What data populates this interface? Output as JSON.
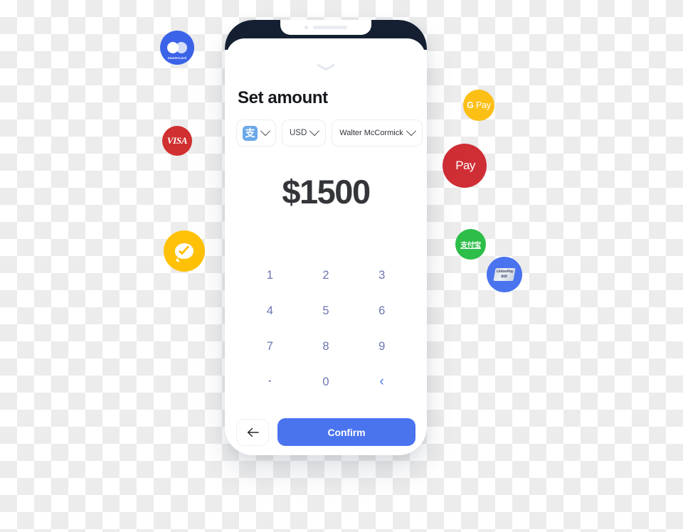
{
  "screen": {
    "title": "Set amount",
    "amount": "$1500",
    "selectors": [
      {
        "name": "payment-method",
        "icon": "alipay-icon",
        "glyph": "支",
        "label": ""
      },
      {
        "name": "currency",
        "label": "USD"
      },
      {
        "name": "recipient",
        "label": "Walter McCormick"
      }
    ],
    "keypad": [
      {
        "key": "1",
        "type": "digit"
      },
      {
        "key": "2",
        "type": "digit"
      },
      {
        "key": "3",
        "type": "digit"
      },
      {
        "key": "4",
        "type": "digit"
      },
      {
        "key": "5",
        "type": "digit"
      },
      {
        "key": "6",
        "type": "digit"
      },
      {
        "key": "7",
        "type": "digit"
      },
      {
        "key": "8",
        "type": "digit"
      },
      {
        "key": "9",
        "type": "digit"
      },
      {
        "key": "·",
        "type": "decimal"
      },
      {
        "key": "0",
        "type": "digit"
      },
      {
        "key": "‹",
        "type": "backspace"
      }
    ],
    "back_button_glyph": "←",
    "confirm_label": "Confirm"
  },
  "badges": [
    {
      "name": "mastercard",
      "label": "mastercard",
      "color": "#3b63e8"
    },
    {
      "name": "visa",
      "label": "VISA",
      "color": "#d0302f"
    },
    {
      "name": "wechat-pay",
      "label": "",
      "color": "#ffc107"
    },
    {
      "name": "google-pay",
      "label_g": "G",
      "label_pay": "Pay",
      "color": "#fcbf16"
    },
    {
      "name": "apple-pay",
      "glyph": "",
      "label": "Pay",
      "color": "#cf2e35"
    },
    {
      "name": "alipay",
      "label": "支付宝",
      "color": "#2dbd49"
    },
    {
      "name": "unionpay",
      "label_l1": "UnionPay",
      "label_l2": "银联",
      "color": "#4a73ee"
    }
  ],
  "colors": {
    "accent_blue": "#4a73ee",
    "keypad_text": "#6b74b3",
    "amount_text": "#333539",
    "bezel": "#151f32"
  }
}
